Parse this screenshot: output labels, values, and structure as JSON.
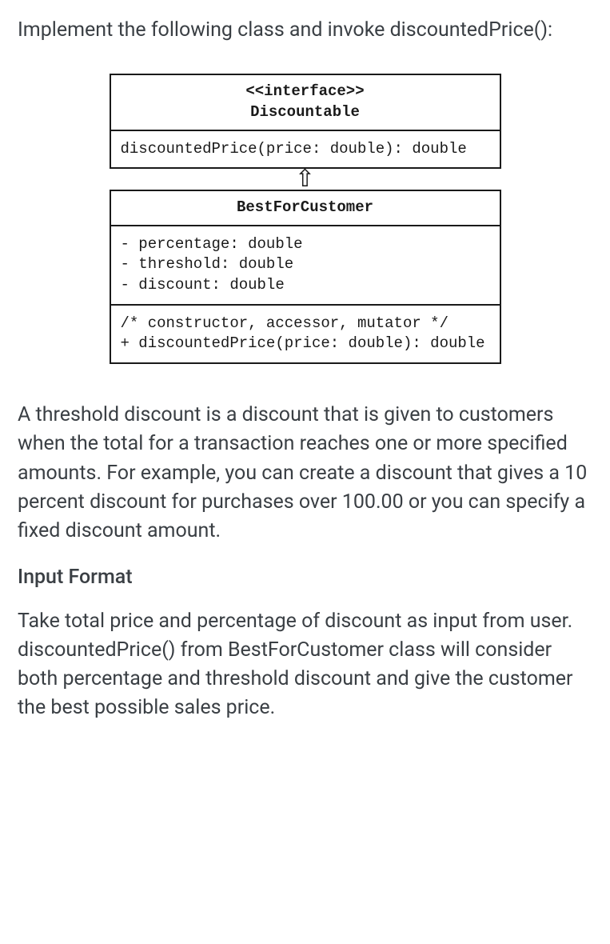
{
  "intro": "Implement the following class and invoke discountedPrice():",
  "uml": {
    "iface": {
      "stereotype": "<<interface>>",
      "name": "Discountable",
      "method": "discountedPrice(price: double): double"
    },
    "cls": {
      "name": "BestForCustomer",
      "attrs": "- percentage: double\n- threshold: double\n- discount: double",
      "ops": "/* constructor, accessor, mutator */\n+ discountedPrice(price: double): double"
    }
  },
  "desc": "A threshold discount is a discount that is given to customers when the total for a transaction reaches one or more specified amounts. For example, you can create a discount that gives a 10 percent discount for purchases over 100.00 or you can specify a fixed discount amount.",
  "input_heading": "Input Format",
  "input_text": "Take total price and percentage of discount as input from user. discountedPrice() from BestForCustomer class will consider both percentage and threshold discount and give the customer the best possible sales price."
}
